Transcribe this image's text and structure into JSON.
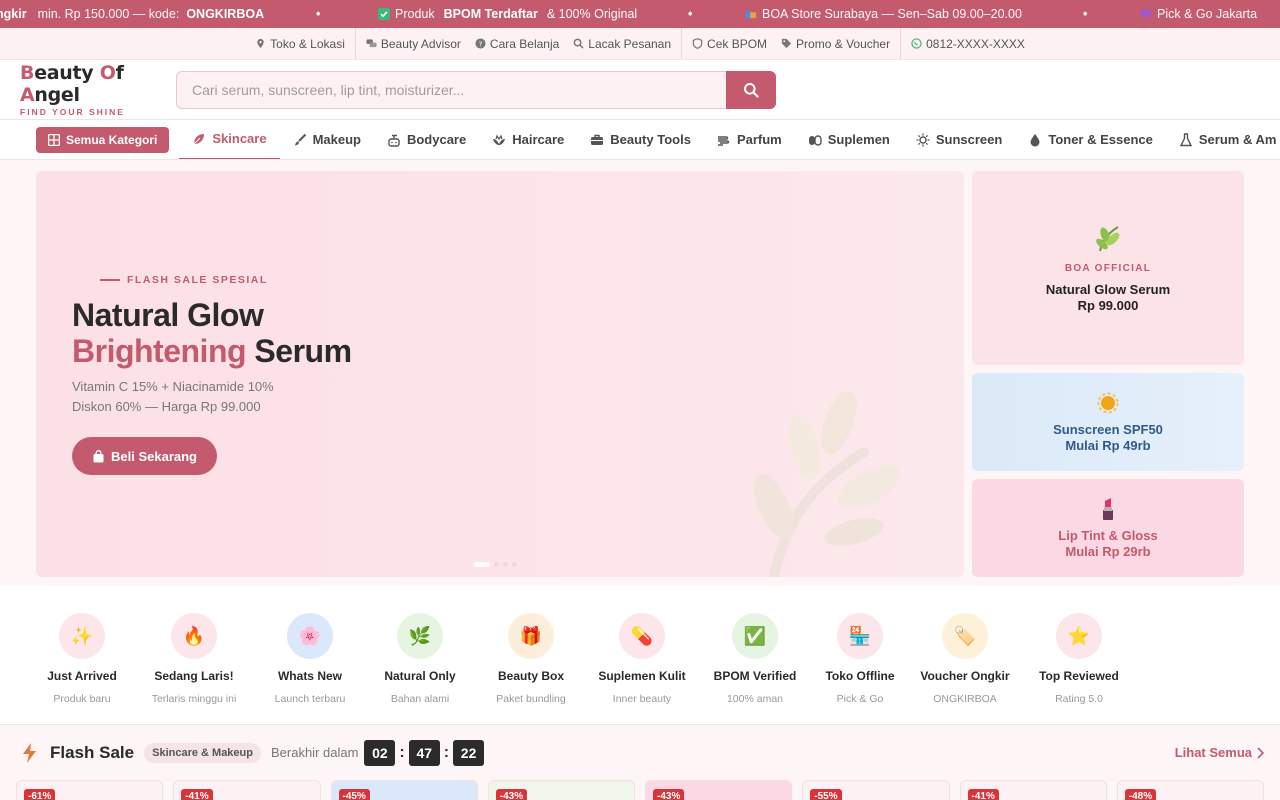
{
  "ticker": {
    "item1_b": "ngkir",
    "item1_n": "min. Rp 150.000 — kode:",
    "item1_code": "ONGKIRBOA",
    "item2_pre": "Produk",
    "item2_b": "BPOM Terdaftar",
    "item2_n": "& 100% Original",
    "item3": "BOA Store Surabaya — Sen–Sab 09.00–20.00",
    "item4": "Pick & Go Jakarta",
    "dot": "•"
  },
  "utilbar": {
    "items": [
      "Toko & Lokasi",
      "Beauty Advisor",
      "Cara Belanja",
      "Lacak Pesanan",
      "Cek BPOM",
      "Promo & Voucher",
      "0812-XXXX-XXXX"
    ]
  },
  "header": {
    "logo_b": "B",
    "logo_1": "eauty ",
    "logo_o": "O",
    "logo_2": "f ",
    "logo_a": "A",
    "logo_3": "ngel",
    "tagline": "FIND YOUR SHINE",
    "search_placeholder": "Cari serum, sunscreen, lip tint, moisturizer..."
  },
  "catnav": {
    "all_label": "Semua Kategori",
    "items": [
      "Skincare",
      "Makeup",
      "Bodycare",
      "Haircare",
      "Beauty Tools",
      "Parfum",
      "Suplemen",
      "Sunscreen",
      "Toner & Essence",
      "Serum & Am"
    ]
  },
  "hero": {
    "kicker": "FLASH SALE SPESIAL",
    "title_1": "Natural Glow",
    "title_2a": "Brightening",
    "title_2b": " Serum",
    "sub_1": "Vitamin C 15% + Niacinamide 10%",
    "sub_2": "Diskon 60% — Harga Rp 99.000",
    "cta": "Beli Sekarang"
  },
  "side": {
    "card1_kicker": "BOA OFFICIAL",
    "card1_title": "Natural Glow Serum",
    "card1_price": "Rp 99.000",
    "card2_title": "Sunscreen SPF50",
    "card2_price": "Mulai Rp 49rb",
    "card3_title": "Lip Tint & Gloss",
    "card3_price": "Mulai Rp 29rb"
  },
  "quicklinks": [
    {
      "title": "Just Arrived",
      "sub": "Produk baru",
      "emoji": "✨",
      "bg": "#fde6ea"
    },
    {
      "title": "Sedang Laris!",
      "sub": "Terlaris minggu ini",
      "emoji": "🔥",
      "bg": "#fde6ea"
    },
    {
      "title": "Whats New",
      "sub": "Launch terbaru",
      "emoji": "🌸",
      "bg": "#dbe7fb"
    },
    {
      "title": "Natural Only",
      "sub": "Bahan alami",
      "emoji": "🌿",
      "bg": "#e6f5e2"
    },
    {
      "title": "Beauty Box",
      "sub": "Paket bundling",
      "emoji": "🎁",
      "bg": "#fdeedc"
    },
    {
      "title": "Suplemen Kulit",
      "sub": "Inner beauty",
      "emoji": "💊",
      "bg": "#fde6ea"
    },
    {
      "title": "BPOM Verified",
      "sub": "100% aman",
      "emoji": "✅",
      "bg": "#e6f5e2"
    },
    {
      "title": "Toko Offline",
      "sub": "Pick & Go",
      "emoji": "🏪",
      "bg": "#fde6ea"
    },
    {
      "title": "Voucher Ongkir",
      "sub": "ONGKIRBOA",
      "emoji": "🏷️",
      "bg": "#fdf2d8"
    },
    {
      "title": "Top Reviewed",
      "sub": "Rating 5.0",
      "emoji": "⭐",
      "bg": "#fde6ea"
    }
  ],
  "flashsale": {
    "title": "Flash Sale",
    "badge": "Skincare & Makeup",
    "ends": "Berakhir dalam",
    "hh": "02",
    "mm": "47",
    "ss": "22",
    "sep": ":",
    "see_all": "Lihat Semua",
    "discounts": [
      "-61%",
      "-41%",
      "-45%",
      "-43%",
      "-43%",
      "-55%",
      "-41%",
      "-48%"
    ]
  },
  "colors": {
    "brand": "#c45a6e",
    "ticker_bg": "#c45a6e",
    "soft_pink": "#fdf1f3",
    "discount_red": "#d9343a"
  }
}
